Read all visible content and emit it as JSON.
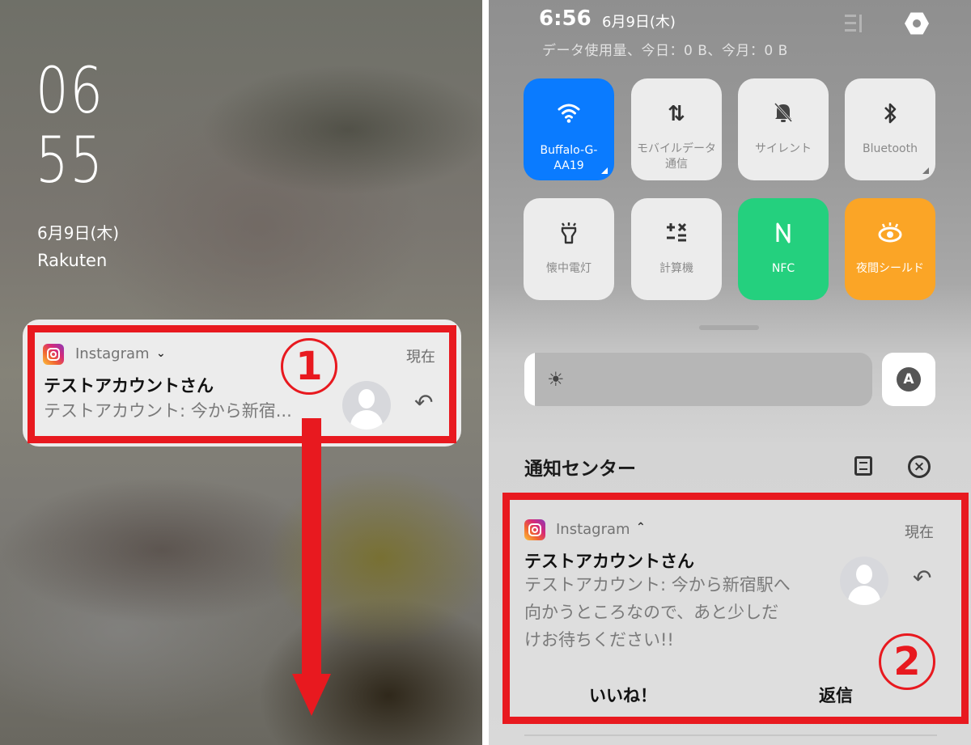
{
  "lock_screen": {
    "clock_hour": "06",
    "clock_minute": "55",
    "date": "6月9日(木)",
    "carrier": "Rakuten",
    "notification": {
      "app_name": "Instagram",
      "expand_icon": "chevron-down-icon",
      "time": "現在",
      "title": "テストアカウントさん",
      "body": "テストアカウント: 今から新宿..."
    },
    "annotation_step": "1",
    "annotation_color": "#e8191f",
    "gesture": "swipe-down-arrow"
  },
  "quick_panel": {
    "status_bar": {
      "time": "6:56",
      "date": "6月9日(木)",
      "data_usage": "データ使用量、今日：0 B、今月：0 B"
    },
    "tiles": [
      {
        "id": "wifi",
        "label": "Buffalo-G-AA19",
        "icon": "wifi-icon",
        "active": true,
        "color": "#0a7bff"
      },
      {
        "id": "mobile-data",
        "label": "モバイルデータ通信",
        "icon": "data-arrows-icon",
        "active": false
      },
      {
        "id": "silent",
        "label": "サイレント",
        "icon": "bell-off-icon",
        "active": false
      },
      {
        "id": "bluetooth",
        "label": "Bluetooth",
        "icon": "bluetooth-icon",
        "active": false
      },
      {
        "id": "flashlight",
        "label": "懐中電灯",
        "icon": "flashlight-icon",
        "active": false
      },
      {
        "id": "calculator",
        "label": "計算機",
        "icon": "calculator-icon",
        "active": false
      },
      {
        "id": "nfc",
        "label": "NFC",
        "icon": "nfc-icon",
        "active": true,
        "color": "#24d07e"
      },
      {
        "id": "night-shield",
        "label": "夜間シールド",
        "icon": "eye-icon",
        "active": true,
        "color": "#fba526"
      }
    ],
    "brightness": {
      "level_percent": 3,
      "auto_label": "A"
    },
    "notification_center": {
      "title": "通知センター",
      "notification": {
        "app_name": "Instagram",
        "collapse_icon": "chevron-up-icon",
        "time": "現在",
        "title": "テストアカウントさん",
        "body_lines": [
          "テストアカウント: 今から新宿駅へ",
          "向かうところなので、あと少しだ",
          "けお待ちください!!"
        ],
        "actions": [
          "いいね！",
          "返信"
        ]
      }
    },
    "annotation_step": "2"
  }
}
